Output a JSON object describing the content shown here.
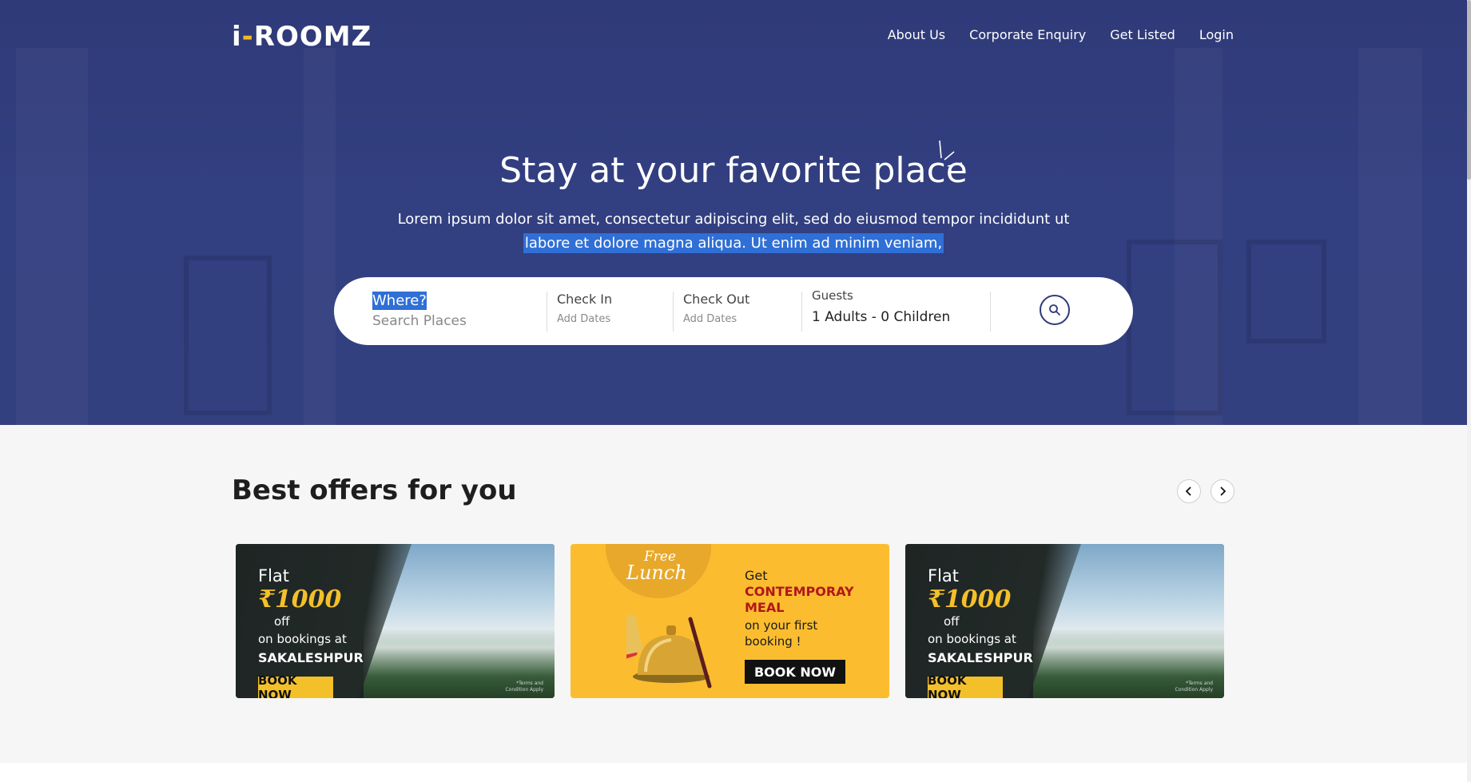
{
  "brand": {
    "logo_left": "i",
    "logo_dash": "-",
    "logo_right": "ROOMZ"
  },
  "nav": {
    "items": [
      {
        "label": "About Us"
      },
      {
        "label": "Corporate Enquiry"
      },
      {
        "label": "Get Listed"
      },
      {
        "label": "Login"
      }
    ]
  },
  "hero": {
    "title": "Stay at your favorite place",
    "lead_line1": "Lorem ipsum dolor sit amet, consectetur adipiscing elit, sed do eiusmod tempor incididunt ut",
    "lead_line2_selected": "labore et dolore magna aliqua. Ut enim ad minim veniam,"
  },
  "search": {
    "where_label": "Where?",
    "where_placeholder": "Search Places",
    "checkin_label": "Check In",
    "checkin_value": "Add Dates",
    "checkout_label": "Check Out",
    "checkout_value": "Add Dates",
    "guests_label": "Guests",
    "guests_value": "1 Adults - 0 Children",
    "button_icon": "search-icon"
  },
  "offers": {
    "title": "Best offers for you",
    "prev_icon": "chevron-left-icon",
    "next_icon": "chevron-right-icon",
    "cards": [
      {
        "flat": "Flat",
        "amount": "₹1000",
        "off": "off",
        "on": "on bookings at",
        "place": "SAKALESHPUR",
        "cta": "BOOK NOW",
        "terms1": "*Terms and",
        "terms2": "Condition Apply"
      },
      {
        "free": "Free",
        "lunch": "Lunch",
        "get": "Get",
        "meal": "CONTEMPORAY MEAL",
        "first": "on your first booking !",
        "cta": "BOOK NOW"
      },
      {
        "flat": "Flat",
        "amount": "₹1000",
        "off": "off",
        "on": "on bookings at",
        "place": "SAKALESHPUR",
        "cta": "BOOK NOW",
        "terms1": "*Terms and",
        "terms2": "Condition Apply"
      }
    ]
  },
  "colors": {
    "hero": "#323f80",
    "accent": "#f4c02a",
    "selection": "#2f6fd6",
    "lunch": "#fbbd2f",
    "meal_red": "#b3161b"
  }
}
